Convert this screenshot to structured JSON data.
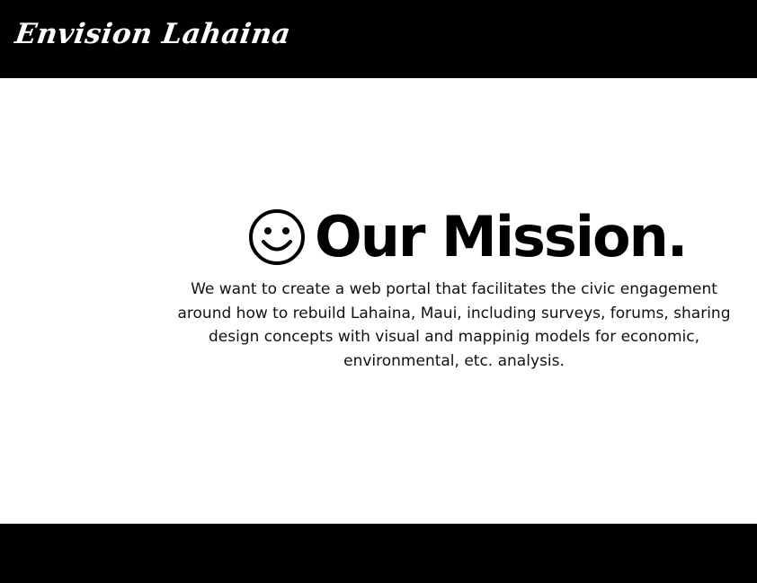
{
  "header": {
    "brand": "Envision Lahaina"
  },
  "mission": {
    "icon": "smiley-face-icon",
    "title": "Our Mission.",
    "text": "We want to create a web portal that facilitates the civic engagement around how to rebuild Lahaina, Maui, including surveys, forums, sharing design concepts with visual and mappinig models for economic, environmental, etc. analysis."
  },
  "colors": {
    "header_bg": "#000000",
    "footer_bg": "#000000",
    "page_bg": "#ffffff",
    "text": "#000000"
  }
}
